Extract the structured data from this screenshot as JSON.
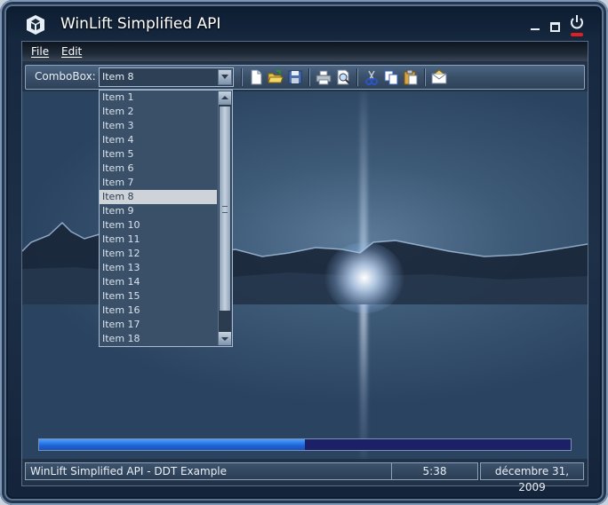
{
  "window": {
    "title": "WinLift Simplified API",
    "icons": [
      "app-logo-icon",
      "minimize-icon",
      "maximize-icon",
      "power-icon"
    ]
  },
  "menu": {
    "items": [
      "File",
      "Edit"
    ]
  },
  "toolbar": {
    "combo_label": "ComboBox:",
    "combo_value": "Item 8",
    "buttons": [
      "new-document-icon",
      "open-folder-icon",
      "save-icon",
      "print-icon",
      "print-preview-icon",
      "cut-icon",
      "copy-icon",
      "paste-icon",
      "email-icon"
    ]
  },
  "dropdown": {
    "items": [
      "Item 1",
      "Item 2",
      "Item 3",
      "Item 4",
      "Item 5",
      "Item 6",
      "Item 7",
      "Item 8",
      "Item 9",
      "Item 10",
      "Item 11",
      "Item 12",
      "Item 13",
      "Item 14",
      "Item 15",
      "Item 16",
      "Item 17",
      "Item 18"
    ],
    "selected_index": 7
  },
  "progress": {
    "value_fraction": 0.5
  },
  "status": {
    "message": "WinLift Simplified API - DDT Example",
    "time": "5:38",
    "date": "décembre 31, 2009"
  },
  "colors": {
    "accent": "#1e63d8",
    "progress_track": "#1c2066",
    "selection": "#cdd3d9",
    "close_indicator": "#e02020"
  }
}
